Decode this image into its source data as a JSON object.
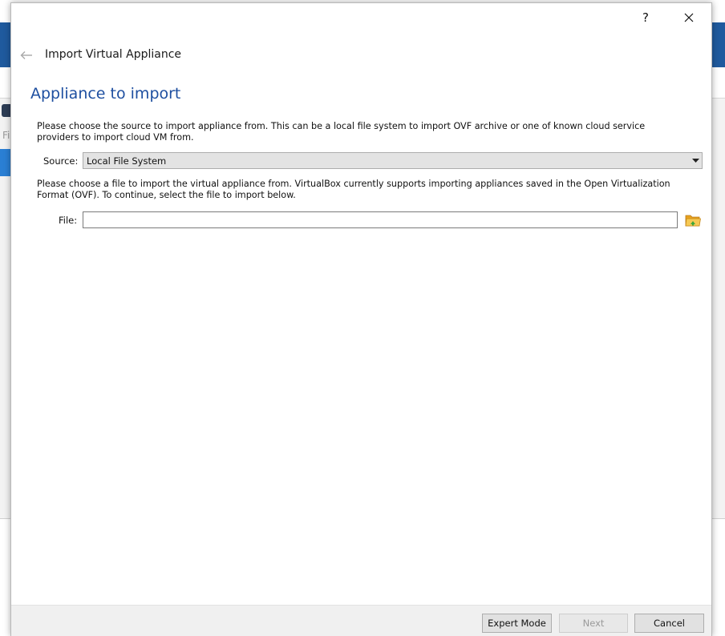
{
  "background": {
    "sidebar_text": "Fi"
  },
  "dialog": {
    "help_label": "?",
    "wizard_title": "Import Virtual Appliance",
    "page_title": "Appliance to import",
    "source_description": "Please choose the source to import appliance from. This can be a local file system to import OVF archive or one of known cloud service providers to import cloud VM from.",
    "source": {
      "label": "Source:",
      "selected": "Local File System"
    },
    "file_description": "Please choose a file to import the virtual appliance from. VirtualBox currently supports importing appliances saved in the Open Virtualization Format (OVF). To continue, select the file to import below.",
    "file": {
      "label": "File:",
      "value": ""
    },
    "buttons": {
      "expert_mode": "Expert Mode",
      "next": "Next",
      "cancel": "Cancel"
    }
  },
  "colors": {
    "accent_title": "#1e4fa0",
    "background_band": "#1f5a9e",
    "folder_icon": "#f2b230"
  }
}
